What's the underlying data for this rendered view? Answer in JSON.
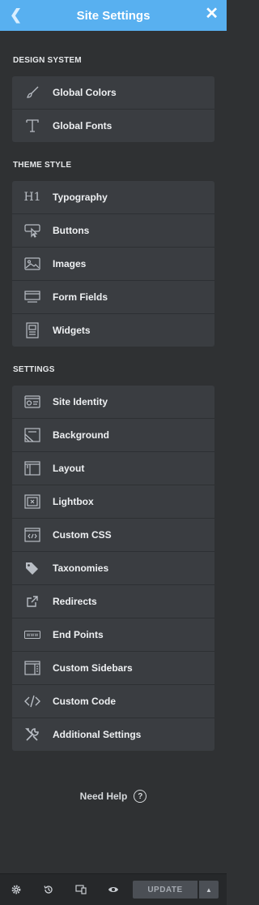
{
  "header": {
    "title": "Site Settings",
    "back_icon": "chevron-left-icon",
    "close_icon": "close-icon"
  },
  "sections": [
    {
      "title": "DESIGN SYSTEM",
      "items": [
        {
          "label": "Global Colors",
          "icon": "brush-icon"
        },
        {
          "label": "Global Fonts",
          "icon": "font-icon"
        }
      ]
    },
    {
      "title": "THEME STYLE",
      "items": [
        {
          "label": "Typography",
          "icon": "h1-icon"
        },
        {
          "label": "Buttons",
          "icon": "button-cursor-icon"
        },
        {
          "label": "Images",
          "icon": "image-icon"
        },
        {
          "label": "Form Fields",
          "icon": "form-field-icon"
        },
        {
          "label": "Widgets",
          "icon": "widgets-icon"
        }
      ]
    },
    {
      "title": "SETTINGS",
      "items": [
        {
          "label": "Site Identity",
          "icon": "site-identity-icon"
        },
        {
          "label": "Background",
          "icon": "background-icon"
        },
        {
          "label": "Layout",
          "icon": "layout-icon"
        },
        {
          "label": "Lightbox",
          "icon": "lightbox-icon"
        },
        {
          "label": "Custom CSS",
          "icon": "custom-css-icon"
        },
        {
          "label": "Taxonomies",
          "icon": "tags-icon"
        },
        {
          "label": "Redirects",
          "icon": "external-link-icon"
        },
        {
          "label": "End Points",
          "icon": "www-icon"
        },
        {
          "label": "Custom Sidebars",
          "icon": "sidebar-icon"
        },
        {
          "label": "Custom Code",
          "icon": "code-icon"
        },
        {
          "label": "Additional Settings",
          "icon": "tools-icon"
        }
      ]
    }
  ],
  "help": {
    "label": "Need Help",
    "icon": "question-icon"
  },
  "footer": {
    "icons": [
      "gear-icon",
      "history-icon",
      "responsive-icon",
      "eye-icon"
    ],
    "update_label": "UPDATE",
    "update_arrow_icon": "caret-up-icon"
  },
  "colors": {
    "header": "#58b0f0",
    "panel": "#2f3133",
    "item": "#3a3d41",
    "footer": "#26282a"
  }
}
